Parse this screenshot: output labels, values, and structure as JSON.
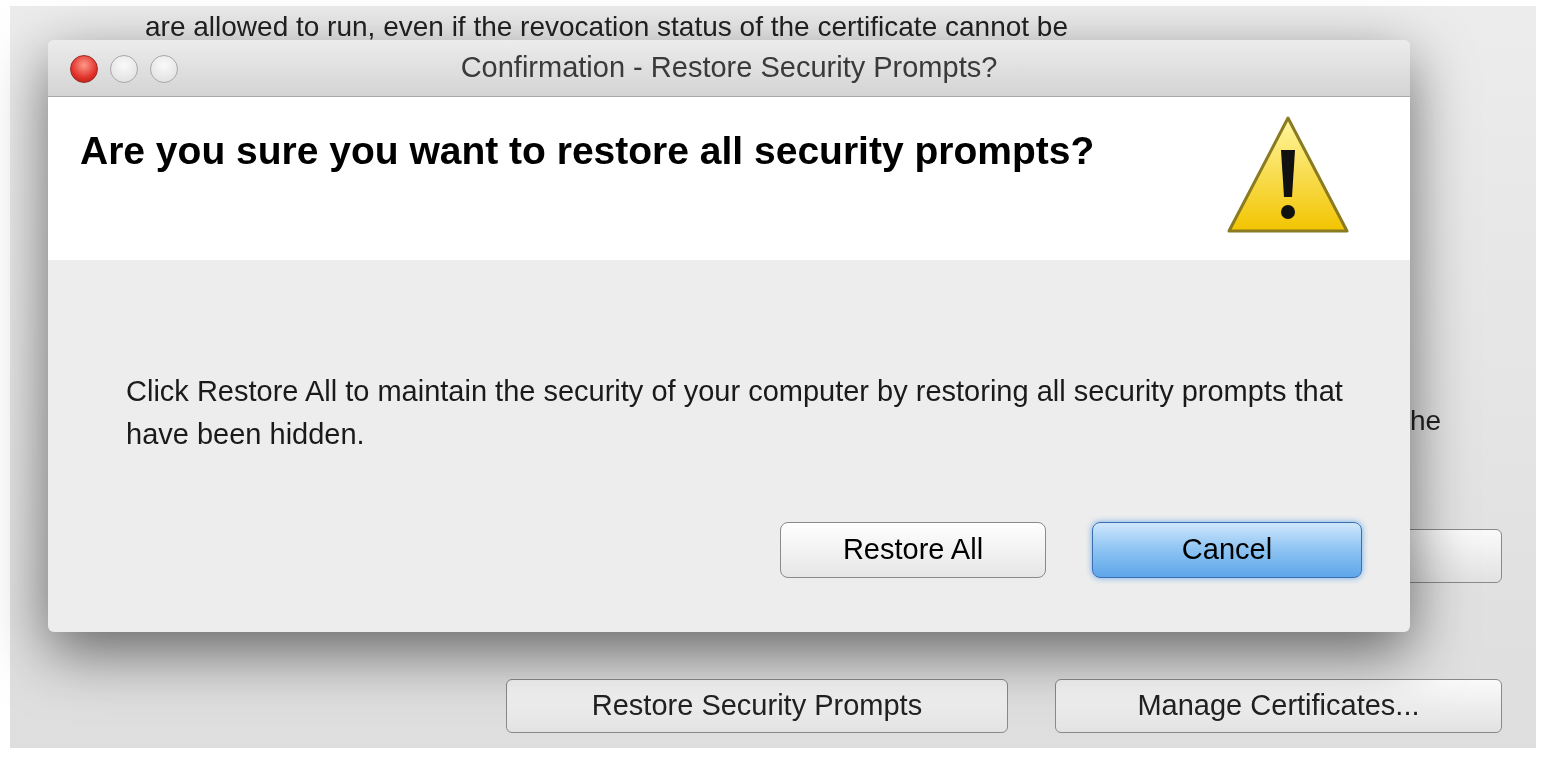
{
  "background_window": {
    "text_lines": [
      "are allowed to run, even if the revocation status of the certificate cannot be",
      "he"
    ],
    "buttons": [
      {
        "label": "Restore Security Prompts"
      },
      {
        "label": "Manage Certificates..."
      }
    ]
  },
  "dialog": {
    "title": "Confirmation - Restore Security Prompts?",
    "heading": "Are you sure you want to restore all security prompts?",
    "message": "Click Restore All to maintain the security of your computer by restoring all security prompts that have been hidden.",
    "buttons": [
      {
        "label": "Restore All",
        "default": false
      },
      {
        "label": "Cancel",
        "default": true
      }
    ]
  }
}
